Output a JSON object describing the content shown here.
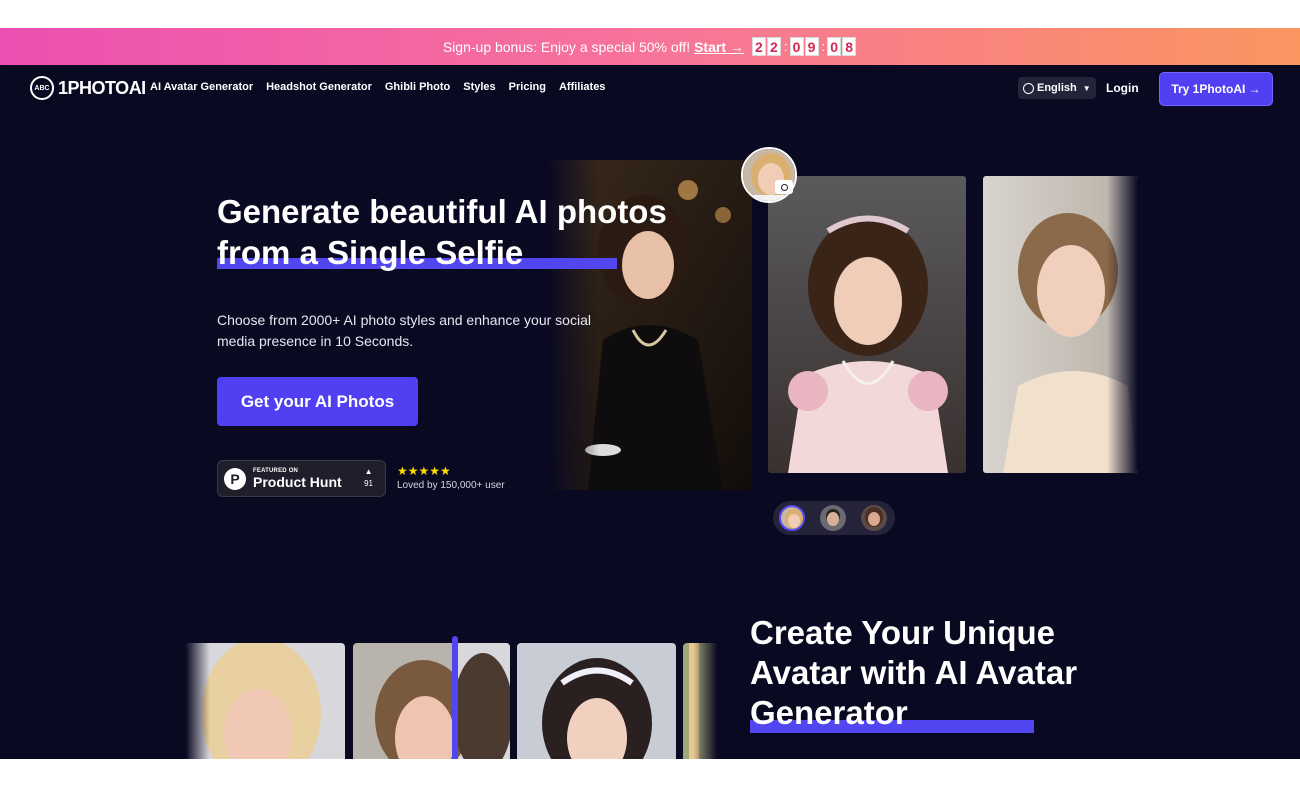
{
  "banner": {
    "text": "Sign-up bonus: Enjoy a special 50% off!",
    "link": "Start →",
    "countdown": [
      "2",
      "2",
      "0",
      "9",
      "0",
      "8"
    ]
  },
  "nav": {
    "logo_mark": "ABC",
    "logo": "1PHOTOAI",
    "items": [
      "AI Avatar Generator",
      "Headshot Generator",
      "Ghibli Photo",
      "Styles",
      "Pricing",
      "Affiliates"
    ],
    "language": "English",
    "login": "Login",
    "cta": "Try 1PhotoAI →"
  },
  "hero": {
    "title": "Generate beautiful AI photos from a Single Selfie",
    "subtitle": "Choose from 2000+ AI photo styles and enhance your social media presence in 10 Seconds.",
    "cta": "Get your AI Photos",
    "product_hunt": {
      "featured": "FEATURED ON",
      "name": "Product Hunt",
      "votes": "91",
      "arrow": "▲"
    },
    "stars": "★★★★★",
    "loved": "Loved by 150,000+ user"
  },
  "section2": {
    "title": "Create Your Unique Avatar with AI Avatar Generator"
  },
  "colors": {
    "background": "#0a0922",
    "accent": "#5140f2",
    "banner_start": "#ec4fb1",
    "banner_end": "#fb955f"
  }
}
